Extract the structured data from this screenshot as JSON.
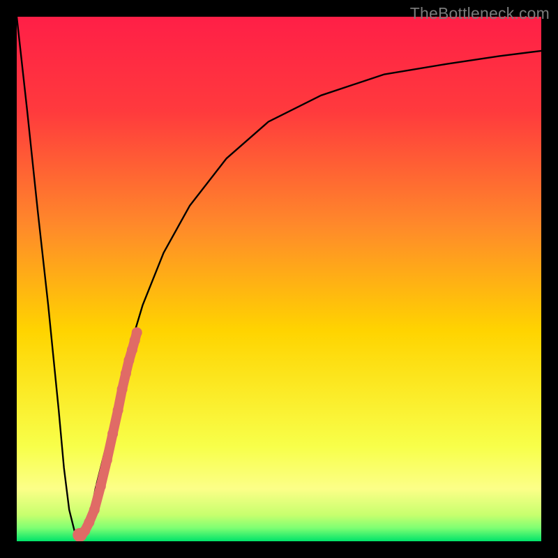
{
  "watermark": "TheBottleneck.com",
  "colors": {
    "gradient_top": "#ff1f47",
    "gradient_mid_upper": "#ff7a2e",
    "gradient_mid": "#ffd400",
    "gradient_mid_lower": "#f8ff4a",
    "gradient_yellow_band": "#fcff88",
    "gradient_bottom": "#00e36a",
    "curve": "#000000",
    "dots": "#e06b66",
    "frame": "#000000"
  },
  "chart_data": {
    "type": "line",
    "title": "",
    "xlabel": "",
    "ylabel": "",
    "xlim": [
      0,
      100
    ],
    "ylim": [
      0,
      100
    ],
    "series": [
      {
        "name": "bottleneck-curve",
        "x": [
          0,
          2,
          4,
          6,
          8,
          9,
          10,
          11,
          12,
          13,
          14,
          15,
          17,
          19,
          21,
          24,
          28,
          33,
          40,
          48,
          58,
          70,
          82,
          92,
          100
        ],
        "y": [
          100,
          82,
          63,
          45,
          25,
          14,
          6,
          2,
          1,
          2,
          5,
          10,
          18,
          27,
          35,
          45,
          55,
          64,
          73,
          80,
          85,
          89,
          91,
          92.5,
          93.5
        ]
      }
    ],
    "highlight_dots": {
      "name": "highlight-segment",
      "x": [
        12.3,
        13.0,
        13.8,
        14.8,
        16.0,
        17.2,
        18.3,
        19.3,
        20.1,
        20.8,
        21.4,
        22.0,
        22.5,
        22.9
      ],
      "y": [
        1.0,
        2.0,
        3.6,
        6.0,
        10.5,
        15.5,
        20.5,
        25.0,
        29.0,
        32.0,
        34.5,
        36.5,
        38.3,
        39.8
      ]
    }
  }
}
